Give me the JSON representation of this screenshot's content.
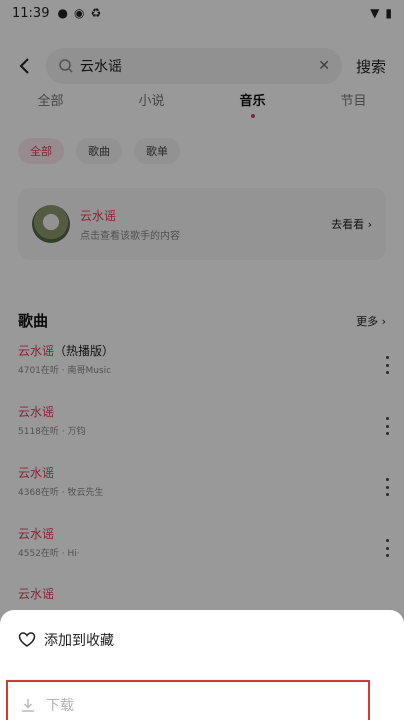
{
  "status_bar": {
    "time": "11:39"
  },
  "search": {
    "query": "云水谣",
    "submit_label": "搜索"
  },
  "tabs": [
    {
      "label": "全部"
    },
    {
      "label": "小说"
    },
    {
      "label": "音乐"
    },
    {
      "label": "节目"
    }
  ],
  "filter_chips": [
    {
      "label": "全部"
    },
    {
      "label": "歌曲"
    },
    {
      "label": "歌单"
    }
  ],
  "artist": {
    "name": "云水谣",
    "description": "点击查看该歌手的内容",
    "action": "去看看 ›"
  },
  "songs_section": {
    "title": "歌曲",
    "more": "更多 ›"
  },
  "songs": [
    {
      "title": "云水谣",
      "suffix": "（热播版）",
      "meta": "4701在听 · 南哥Music"
    },
    {
      "title": "云水谣",
      "suffix": "",
      "meta": "5118在听 · 万钧"
    },
    {
      "title": "云水谣",
      "suffix": "",
      "meta": "4368在听 · 牧云先生"
    },
    {
      "title": "云水谣",
      "suffix": "",
      "meta": "4552在听 · Hi·"
    },
    {
      "title": "云水谣",
      "suffix": "",
      "meta": ""
    }
  ],
  "sheet": {
    "favorite_label": "添加到收藏",
    "download_label": "下载"
  },
  "colors": {
    "accent": "#e23b5a",
    "highlight_border": "#e0332f"
  }
}
